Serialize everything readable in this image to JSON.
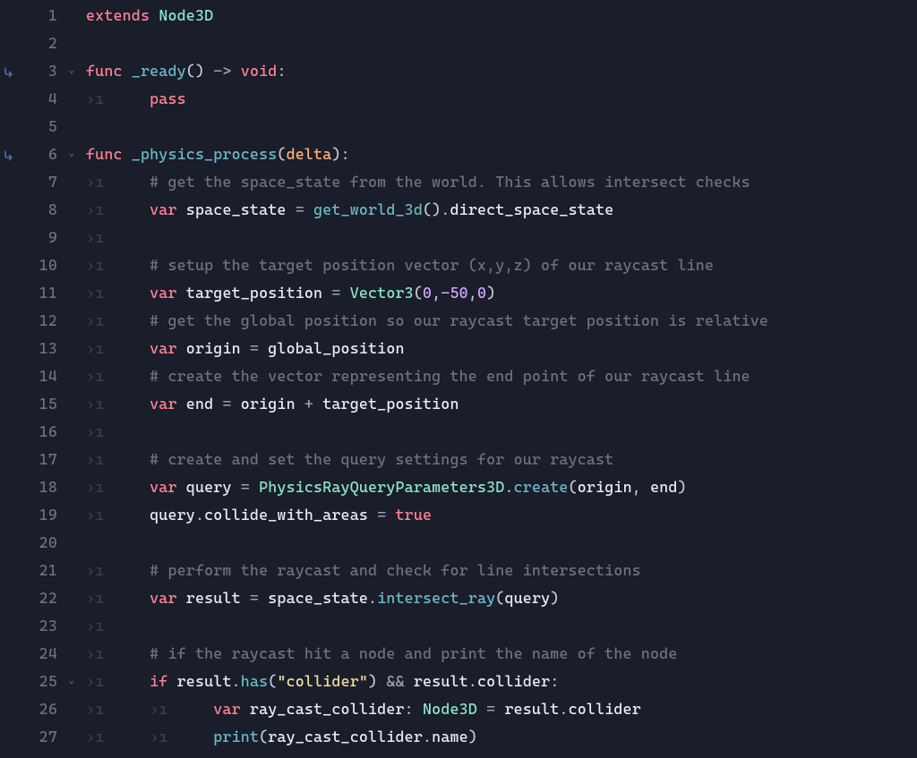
{
  "lines": [
    {
      "num": "1",
      "icon": "",
      "fold": "",
      "tokens": [
        {
          "t": "extends",
          "c": "kw"
        },
        {
          "t": " ",
          "c": ""
        },
        {
          "t": "Node3D",
          "c": "cls"
        }
      ]
    },
    {
      "num": "2",
      "icon": "",
      "fold": "",
      "tokens": []
    },
    {
      "num": "3",
      "icon": "↪",
      "fold": "v",
      "tokens": [
        {
          "t": "func",
          "c": "kw"
        },
        {
          "t": " ",
          "c": ""
        },
        {
          "t": "_ready",
          "c": "fn"
        },
        {
          "t": "()",
          "c": "punc"
        },
        {
          "t": " -> ",
          "c": "op"
        },
        {
          "t": "void",
          "c": "kw"
        },
        {
          "t": ":",
          "c": "punc"
        }
      ]
    },
    {
      "num": "4",
      "icon": "",
      "fold": "",
      "tokens": [
        {
          "t": "⇥   ",
          "c": "ws"
        },
        {
          "t": "pass",
          "c": "kw"
        }
      ]
    },
    {
      "num": "5",
      "icon": "",
      "fold": "",
      "tokens": []
    },
    {
      "num": "6",
      "icon": "↪",
      "fold": "v",
      "tokens": [
        {
          "t": "func",
          "c": "kw"
        },
        {
          "t": " ",
          "c": ""
        },
        {
          "t": "_physics_process",
          "c": "fn"
        },
        {
          "t": "(",
          "c": "punc"
        },
        {
          "t": "delta",
          "c": "parm"
        },
        {
          "t": ")",
          "c": "punc"
        },
        {
          "t": ":",
          "c": "punc"
        }
      ]
    },
    {
      "num": "7",
      "icon": "",
      "fold": "",
      "tokens": [
        {
          "t": "⇥   ",
          "c": "ws"
        },
        {
          "t": "# get the space_state from the world. This allows intersect checks",
          "c": "cmt"
        }
      ]
    },
    {
      "num": "8",
      "icon": "",
      "fold": "",
      "tokens": [
        {
          "t": "⇥   ",
          "c": "ws"
        },
        {
          "t": "var",
          "c": "kw"
        },
        {
          "t": " ",
          "c": ""
        },
        {
          "t": "space_state",
          "c": "id"
        },
        {
          "t": " = ",
          "c": "op"
        },
        {
          "t": "get_world_3d",
          "c": "fn"
        },
        {
          "t": "()",
          "c": "punc"
        },
        {
          "t": ".",
          "c": "punc"
        },
        {
          "t": "direct_space_state",
          "c": "id"
        }
      ]
    },
    {
      "num": "9",
      "icon": "",
      "fold": "",
      "tokens": [
        {
          "t": "⇥",
          "c": "ws"
        }
      ]
    },
    {
      "num": "10",
      "icon": "",
      "fold": "",
      "tokens": [
        {
          "t": "⇥   ",
          "c": "ws"
        },
        {
          "t": "# setup the target position vector (x,y,z) of our raycast line",
          "c": "cmt"
        }
      ]
    },
    {
      "num": "11",
      "icon": "",
      "fold": "",
      "tokens": [
        {
          "t": "⇥   ",
          "c": "ws"
        },
        {
          "t": "var",
          "c": "kw"
        },
        {
          "t": " ",
          "c": ""
        },
        {
          "t": "target_position",
          "c": "id"
        },
        {
          "t": " = ",
          "c": "op"
        },
        {
          "t": "Vector3",
          "c": "cls"
        },
        {
          "t": "(",
          "c": "punc"
        },
        {
          "t": "0",
          "c": "num"
        },
        {
          "t": ",",
          "c": "punc"
        },
        {
          "t": "-50",
          "c": "num"
        },
        {
          "t": ",",
          "c": "punc"
        },
        {
          "t": "0",
          "c": "num"
        },
        {
          "t": ")",
          "c": "punc"
        }
      ]
    },
    {
      "num": "12",
      "icon": "",
      "fold": "",
      "tokens": [
        {
          "t": "⇥   ",
          "c": "ws"
        },
        {
          "t": "# get the global position so our raycast target position is relative",
          "c": "cmt"
        }
      ]
    },
    {
      "num": "13",
      "icon": "",
      "fold": "",
      "tokens": [
        {
          "t": "⇥   ",
          "c": "ws"
        },
        {
          "t": "var",
          "c": "kw"
        },
        {
          "t": " ",
          "c": ""
        },
        {
          "t": "origin",
          "c": "id"
        },
        {
          "t": " = ",
          "c": "op"
        },
        {
          "t": "global_position",
          "c": "id"
        }
      ]
    },
    {
      "num": "14",
      "icon": "",
      "fold": "",
      "tokens": [
        {
          "t": "⇥   ",
          "c": "ws"
        },
        {
          "t": "# create the vector representing the end point of our raycast line",
          "c": "cmt"
        }
      ]
    },
    {
      "num": "15",
      "icon": "",
      "fold": "",
      "tokens": [
        {
          "t": "⇥   ",
          "c": "ws"
        },
        {
          "t": "var",
          "c": "kw"
        },
        {
          "t": " ",
          "c": ""
        },
        {
          "t": "end",
          "c": "id"
        },
        {
          "t": " = ",
          "c": "op"
        },
        {
          "t": "origin",
          "c": "id"
        },
        {
          "t": " + ",
          "c": "op"
        },
        {
          "t": "target_position",
          "c": "id"
        }
      ]
    },
    {
      "num": "16",
      "icon": "",
      "fold": "",
      "tokens": [
        {
          "t": "⇥",
          "c": "ws"
        }
      ]
    },
    {
      "num": "17",
      "icon": "",
      "fold": "",
      "tokens": [
        {
          "t": "⇥   ",
          "c": "ws"
        },
        {
          "t": "# create and set the query settings for our raycast",
          "c": "cmt"
        }
      ]
    },
    {
      "num": "18",
      "icon": "",
      "fold": "",
      "tokens": [
        {
          "t": "⇥   ",
          "c": "ws"
        },
        {
          "t": "var",
          "c": "kw"
        },
        {
          "t": " ",
          "c": ""
        },
        {
          "t": "query",
          "c": "id"
        },
        {
          "t": " = ",
          "c": "op"
        },
        {
          "t": "PhysicsRayQueryParameters3D",
          "c": "cls"
        },
        {
          "t": ".",
          "c": "punc"
        },
        {
          "t": "create",
          "c": "fn"
        },
        {
          "t": "(",
          "c": "punc"
        },
        {
          "t": "origin",
          "c": "id"
        },
        {
          "t": ", ",
          "c": "punc"
        },
        {
          "t": "end",
          "c": "id"
        },
        {
          "t": ")",
          "c": "punc"
        }
      ]
    },
    {
      "num": "19",
      "icon": "",
      "fold": "",
      "tokens": [
        {
          "t": "⇥   ",
          "c": "ws"
        },
        {
          "t": "query",
          "c": "id"
        },
        {
          "t": ".",
          "c": "punc"
        },
        {
          "t": "collide_with_areas",
          "c": "id"
        },
        {
          "t": " = ",
          "c": "op"
        },
        {
          "t": "true",
          "c": "bool"
        }
      ]
    },
    {
      "num": "20",
      "icon": "",
      "fold": "",
      "tokens": []
    },
    {
      "num": "21",
      "icon": "",
      "fold": "",
      "tokens": [
        {
          "t": "⇥   ",
          "c": "ws"
        },
        {
          "t": "# perform the raycast and check for line intersections",
          "c": "cmt"
        }
      ]
    },
    {
      "num": "22",
      "icon": "",
      "fold": "",
      "tokens": [
        {
          "t": "⇥   ",
          "c": "ws"
        },
        {
          "t": "var",
          "c": "kw"
        },
        {
          "t": " ",
          "c": ""
        },
        {
          "t": "result",
          "c": "id"
        },
        {
          "t": " = ",
          "c": "op"
        },
        {
          "t": "space_state",
          "c": "id"
        },
        {
          "t": ".",
          "c": "punc"
        },
        {
          "t": "intersect_ray",
          "c": "fn"
        },
        {
          "t": "(",
          "c": "punc"
        },
        {
          "t": "query",
          "c": "id"
        },
        {
          "t": ")",
          "c": "punc"
        }
      ]
    },
    {
      "num": "23",
      "icon": "",
      "fold": "",
      "tokens": [
        {
          "t": "⇥",
          "c": "ws"
        }
      ]
    },
    {
      "num": "24",
      "icon": "",
      "fold": "",
      "tokens": [
        {
          "t": "⇥   ",
          "c": "ws"
        },
        {
          "t": "# if the raycast hit a node and print the name of the node",
          "c": "cmt"
        }
      ]
    },
    {
      "num": "25",
      "icon": "",
      "fold": "v",
      "tokens": [
        {
          "t": "⇥   ",
          "c": "ws"
        },
        {
          "t": "if",
          "c": "kw"
        },
        {
          "t": " ",
          "c": ""
        },
        {
          "t": "result",
          "c": "id"
        },
        {
          "t": ".",
          "c": "punc"
        },
        {
          "t": "has",
          "c": "fn"
        },
        {
          "t": "(",
          "c": "punc"
        },
        {
          "t": "\"collider\"",
          "c": "str"
        },
        {
          "t": ")",
          "c": "punc"
        },
        {
          "t": " && ",
          "c": "op"
        },
        {
          "t": "result",
          "c": "id"
        },
        {
          "t": ".",
          "c": "punc"
        },
        {
          "t": "collider",
          "c": "id"
        },
        {
          "t": ":",
          "c": "punc"
        }
      ]
    },
    {
      "num": "26",
      "icon": "",
      "fold": "",
      "tokens": [
        {
          "t": "⇥   ⇥   ",
          "c": "ws"
        },
        {
          "t": "var",
          "c": "kw"
        },
        {
          "t": " ",
          "c": ""
        },
        {
          "t": "ray_cast_collider",
          "c": "id"
        },
        {
          "t": ": ",
          "c": "punc"
        },
        {
          "t": "Node3D",
          "c": "cls"
        },
        {
          "t": " = ",
          "c": "op"
        },
        {
          "t": "result",
          "c": "id"
        },
        {
          "t": ".",
          "c": "punc"
        },
        {
          "t": "collider",
          "c": "id"
        }
      ]
    },
    {
      "num": "27",
      "icon": "",
      "fold": "",
      "tokens": [
        {
          "t": "⇥   ⇥   ",
          "c": "ws"
        },
        {
          "t": "print",
          "c": "fn"
        },
        {
          "t": "(",
          "c": "punc"
        },
        {
          "t": "ray_cast_collider",
          "c": "id"
        },
        {
          "t": ".",
          "c": "punc"
        },
        {
          "t": "name",
          "c": "id"
        },
        {
          "t": ")",
          "c": "punc"
        }
      ]
    }
  ]
}
